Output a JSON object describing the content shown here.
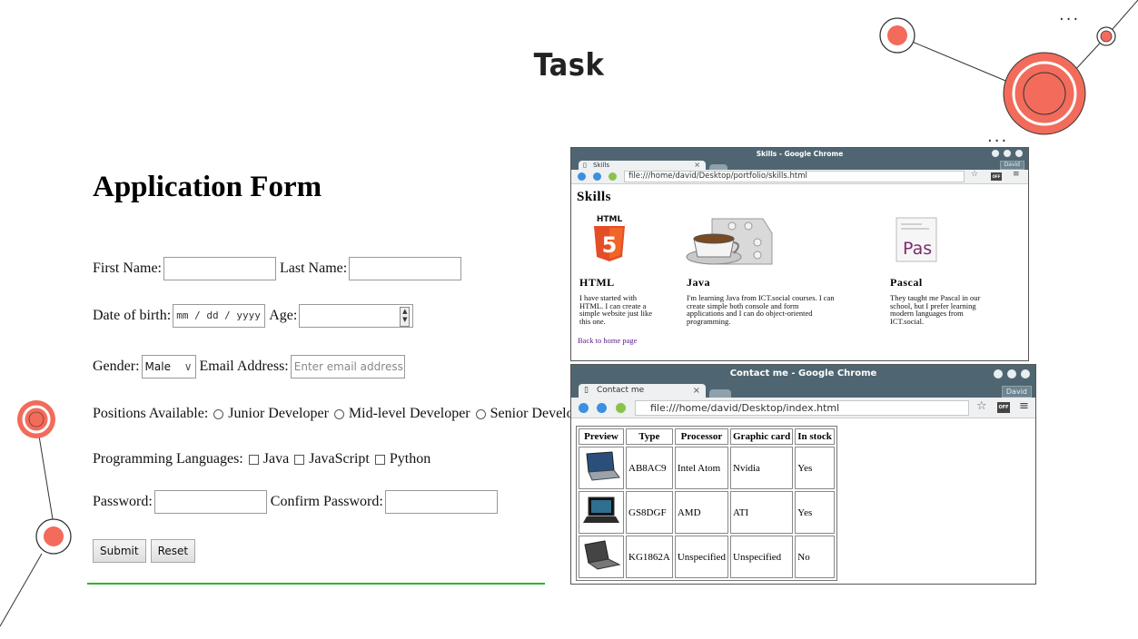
{
  "slide": {
    "title": "Task",
    "dots": "..."
  },
  "form": {
    "title": "Application Form",
    "first_name_label": "First Name:",
    "last_name_label": "Last Name:",
    "dob_label": "Date of birth:",
    "dob_placeholder": "mm / dd / yyyy",
    "age_label": "Age:",
    "gender_label": "Gender:",
    "gender_selected": "Male",
    "email_label": "Email Address:",
    "email_placeholder": "Enter email address",
    "positions_label": "Positions Available:",
    "positions": [
      "Junior Developer",
      "Mid-level Developer",
      "Senior Developer"
    ],
    "languages_label": "Programming Languages:",
    "languages": [
      "Java",
      "JavaScript",
      "Python"
    ],
    "password_label": "Password:",
    "confirm_password_label": "Confirm Password:",
    "submit_label": "Submit",
    "reset_label": "Reset"
  },
  "skills_window": {
    "title": "Skills - Google Chrome",
    "tab_label": "Skills",
    "tab_close": "×",
    "user": "David",
    "url": "file:///home/david/Desktop/portfolio/skills.html",
    "heading": "Skills",
    "html_logo_text": "HTML",
    "pascal_logo_text": "Pas",
    "items": [
      {
        "name": "HTML",
        "text": [
          "I have started with",
          "HTML. I can create a",
          "simple website just like",
          "this one."
        ]
      },
      {
        "name": "Java",
        "text": [
          "I'm learning Java from ICT.social courses. I can",
          "create simple both console and form",
          "applications and I can do object-oriented",
          "programming."
        ]
      },
      {
        "name": "Pascal",
        "text": [
          "They taught me Pascal in our",
          "school, but I prefer learning",
          "modern languages from",
          "ICT.social."
        ]
      }
    ],
    "back_link": "Back to home page"
  },
  "contact_window": {
    "title": "Contact me - Google Chrome",
    "tab_label": "Contact me",
    "tab_close": "×",
    "user": "David",
    "url": "file:///home/david/Desktop/index.html",
    "ext_label": "OFF",
    "table_headers": [
      "Preview",
      "Type",
      "Processor",
      "Graphic card",
      "In stock"
    ],
    "rows": [
      [
        "AB8AC9",
        "Intel Atom",
        "Nvidia",
        "Yes"
      ],
      [
        "GS8DGF",
        "AMD",
        "ATI",
        "Yes"
      ],
      [
        "KG1862A",
        "Unspecified",
        "Unspecified",
        "No"
      ]
    ]
  },
  "colors": {
    "accent": "#f26b5b",
    "titlebar": "#4f6672",
    "divider": "#2db52d"
  }
}
